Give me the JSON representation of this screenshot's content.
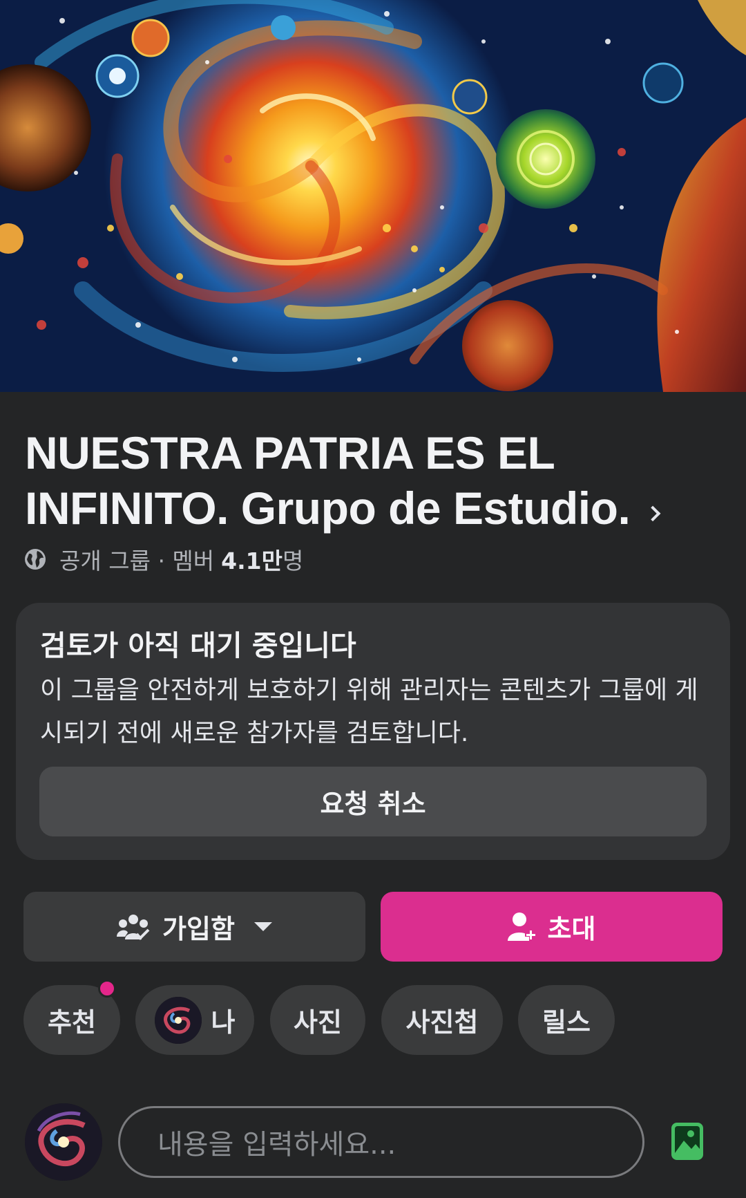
{
  "cover": {
    "image": "cosmic-spiral-galaxy-painting"
  },
  "header": {
    "title": "NUESTRA PATRIA ES EL INFINITO. Grupo de Estudio.",
    "privacy": "공개 그룹",
    "separator": "· 멤버",
    "member_count": "4.1만",
    "member_unit": "명"
  },
  "pending": {
    "title": "검토가 아직 대기 중입니다",
    "body": "이 그룹을 안전하게 보호하기 위해 관리자는 콘텐츠가 그룹에 게시되기 전에 새로운 참가자를 검토합니다.",
    "cancel_label": "요청 취소"
  },
  "actions": {
    "joined_label": "가입함",
    "invite_label": "초대",
    "invite_color": "#db2e8f"
  },
  "tabs": [
    {
      "label": "추천",
      "has_notification": true
    },
    {
      "label": "나",
      "has_avatar": true
    },
    {
      "label": "사진"
    },
    {
      "label": "사진첩"
    },
    {
      "label": "릴스"
    }
  ],
  "composer": {
    "placeholder": "내용을 입력하세요...",
    "photo_icon_color": "#45bd62"
  },
  "colors": {
    "background": "#242526",
    "card": "#333436",
    "accent": "#db2e8f"
  }
}
